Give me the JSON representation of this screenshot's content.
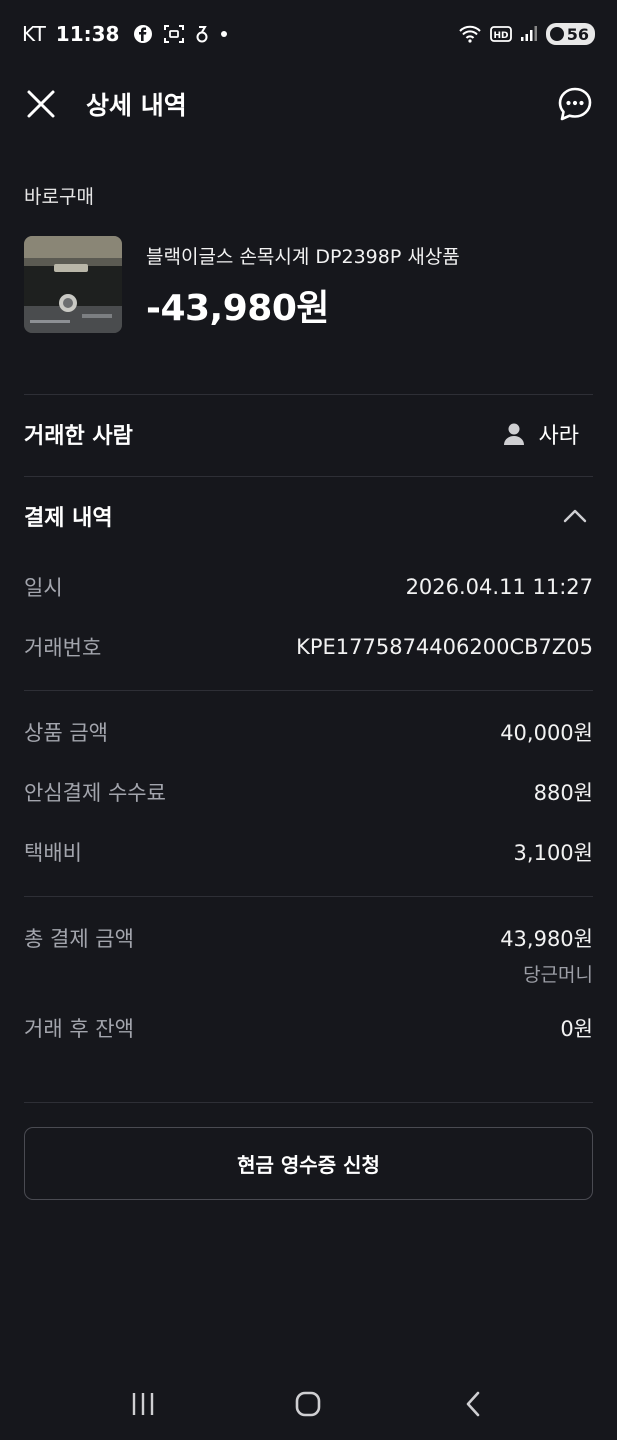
{
  "status_bar": {
    "carrier": "KT",
    "time": "11:38",
    "battery": "56"
  },
  "header": {
    "title": "상세 내역"
  },
  "category": "바로구매",
  "product": {
    "name": "블랙이글스 손목시계 DP2398P 새상품",
    "amount": "-43,980원"
  },
  "counterparty": {
    "label": "거래한 사람",
    "name": "사라"
  },
  "payment": {
    "title": "결제 내역",
    "datetime_label": "일시",
    "datetime_value": "2026.04.11 11:27",
    "txid_label": "거래번호",
    "txid_value": "KPE1775874406200CB7Z05",
    "item_price_label": "상품 금액",
    "item_price_value": "40,000원",
    "fee_label": "안심결제 수수료",
    "fee_value": "880원",
    "shipping_label": "택배비",
    "shipping_value": "3,100원",
    "total_label": "총 결제 금액",
    "total_value": "43,980원",
    "total_method": "당근머니",
    "balance_label": "거래 후 잔액",
    "balance_value": "0원"
  },
  "receipt_button": "현금 영수증 신청",
  "icons": {
    "close": "close-icon",
    "chat": "chat-bubble-icon",
    "person": "person-icon",
    "collapse": "chevron-up-icon",
    "nav_recent": "recent-apps-icon",
    "nav_home": "home-icon",
    "nav_back": "back-icon"
  }
}
